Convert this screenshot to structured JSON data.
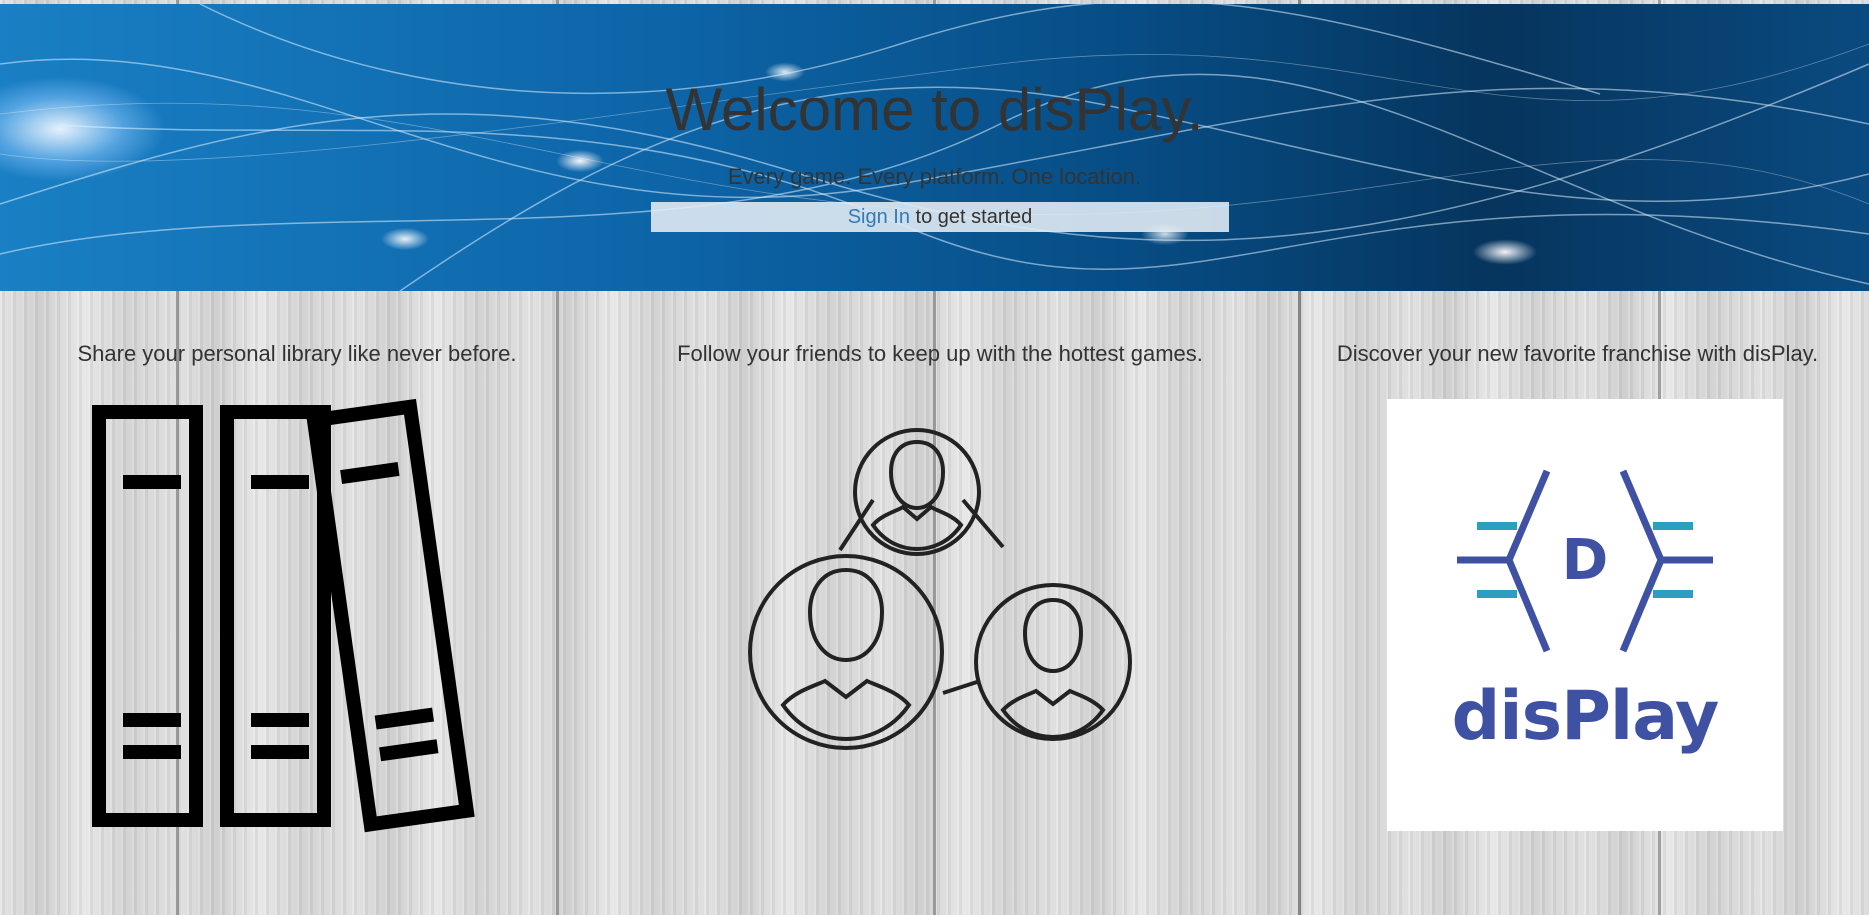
{
  "hero": {
    "title": "Welcome to disPlay.",
    "tagline": "Every game. Every platform. One location.",
    "signin_link": "Sign In",
    "signin_suffix": " to get started"
  },
  "features": [
    {
      "text": "Share your personal library like never before.",
      "icon": "library-books-icon"
    },
    {
      "text": "Follow your friends to keep up with the hottest games.",
      "icon": "friends-network-icon"
    },
    {
      "text": "Discover your new favorite franchise with disPlay.",
      "icon": "display-logo"
    }
  ],
  "logo": {
    "letter": "D",
    "wordmark": "disPlay"
  },
  "colors": {
    "link": "#337ab7",
    "text": "#333333",
    "logo_blue": "#3f51a3",
    "logo_teal": "#2a9fc0"
  }
}
